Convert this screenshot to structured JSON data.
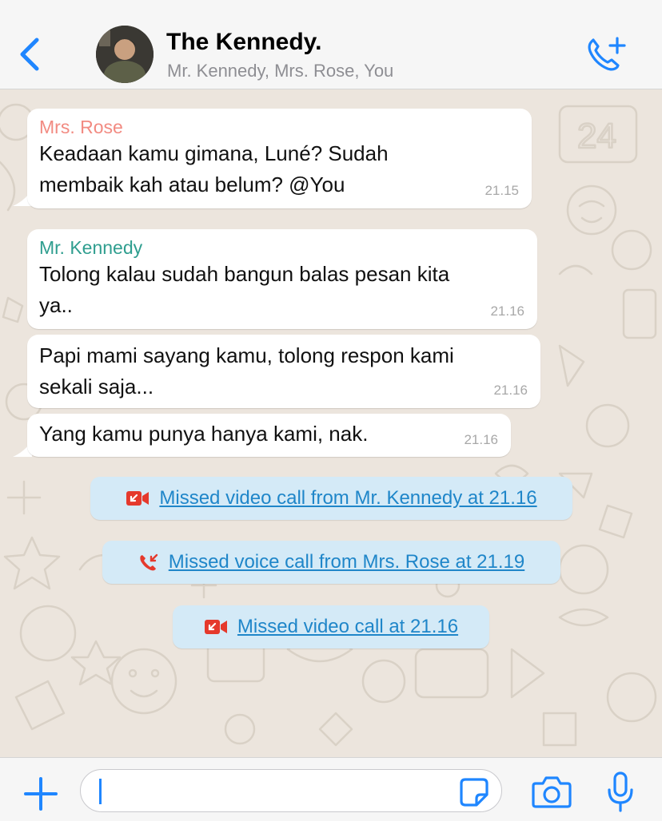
{
  "colors": {
    "accent": "#1f86ff",
    "link": "#1f86c9",
    "rose_name": "#f28b82",
    "kennedy_name": "#2f9e8f",
    "missed_red": "#e5392c",
    "system_bubble": "#d4eaf7",
    "wallpaper": "#ece5dd"
  },
  "header": {
    "title": "The Kennedy.",
    "members": "Mr. Kennedy, Mrs. Rose, You",
    "back_icon": "chevron-left-icon",
    "call_icon": "add-call-icon"
  },
  "messages": [
    {
      "sender": "Mrs. Rose",
      "lines": [
        "Keadaan kamu gimana, Luné? Sudah",
        "membaik kah atau belum? @You"
      ],
      "time": "21.15"
    },
    {
      "sender": "Mr. Kennedy",
      "lines": [
        "Tolong kalau sudah bangun balas pesan kita",
        "ya.."
      ],
      "time": "21.16"
    },
    {
      "sender": "",
      "lines": [
        "Papi mami sayang kamu, tolong respon kami",
        "sekali saja..."
      ],
      "time": "21.16"
    },
    {
      "sender": "",
      "lines": [
        "Yang kamu punya hanya kami, nak."
      ],
      "time": "21.16"
    }
  ],
  "system_notices": [
    {
      "icon": "missed-video-call-icon",
      "text": "Missed video call from Mr. Kennedy at 21.16"
    },
    {
      "icon": "missed-voice-call-icon",
      "text": "Missed voice call from Mrs. Rose at 21.19"
    },
    {
      "icon": "missed-video-call-icon",
      "text": "Missed video call at 21.16"
    }
  ],
  "footer": {
    "input_value": "",
    "plus_icon": "plus-icon",
    "sticker_icon": "sticker-icon",
    "camera_icon": "camera-icon",
    "mic_icon": "microphone-icon"
  }
}
